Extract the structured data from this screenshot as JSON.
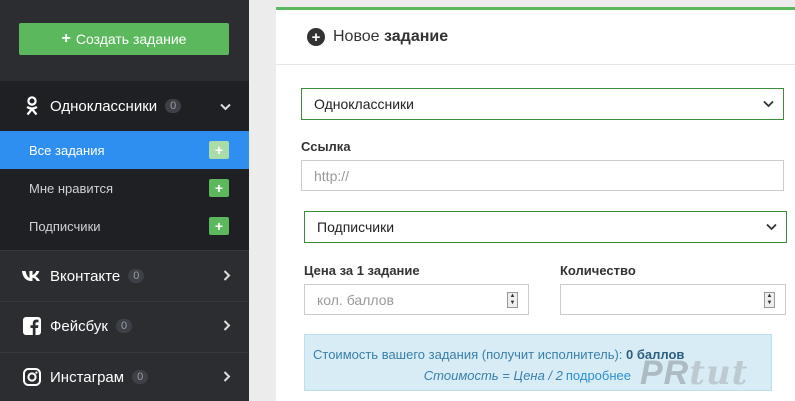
{
  "sidebar": {
    "create_label": "Создать задание",
    "groups": [
      {
        "label": "Одноклассники",
        "count": "0",
        "icon": "odnoklassniki-icon"
      },
      {
        "label": "Вконтакте",
        "count": "0",
        "icon": "vk-icon"
      },
      {
        "label": "Фейсбук",
        "count": "0",
        "icon": "facebook-icon"
      },
      {
        "label": "Инстаграм",
        "count": "0",
        "icon": "instagram-icon"
      }
    ],
    "sub_items": [
      {
        "label": "Все задания"
      },
      {
        "label": "Мне нравится"
      },
      {
        "label": "Подписчики"
      }
    ]
  },
  "panel": {
    "title_prefix": "Новое",
    "title_bold": "задание",
    "network_select": "Одноклассники",
    "link_label": "Ссылка",
    "link_placeholder": "http://",
    "task_type_select": "Подписчики",
    "price_label": "Цена за 1 задание",
    "price_placeholder": "кол. баллов",
    "quantity_label": "Количество",
    "quantity_value": "",
    "cost_text": "Стоимость вашего задания (получит исполнитель): ",
    "cost_value": "0 баллов",
    "formula": "Стоимость = Цена / 2",
    "more_link": "подробнее"
  },
  "watermark": {
    "pr": "PR",
    "tut": "tut"
  },
  "colors": {
    "accent_green": "#5cb85c",
    "active_blue": "#2f8ff0",
    "sidebar_dark": "#2b2d31"
  }
}
